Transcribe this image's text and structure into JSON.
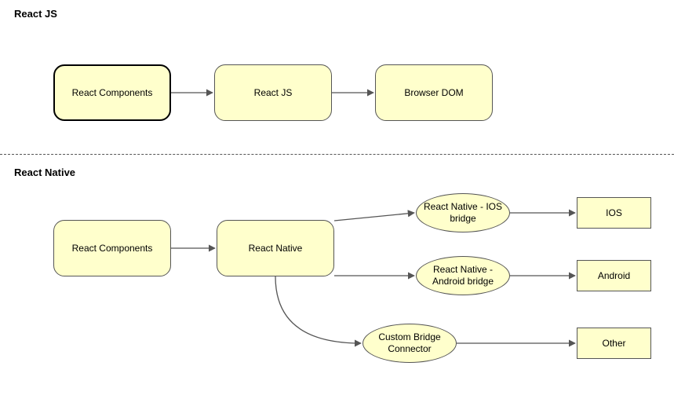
{
  "sections": {
    "reactjs": {
      "title": "React JS"
    },
    "reactnative": {
      "title": "React Native"
    }
  },
  "nodes": {
    "rjs_components": "React Components",
    "rjs_core": "React JS",
    "rjs_dom": "Browser DOM",
    "rn_components": "React Components",
    "rn_core": "React Native",
    "rn_ios_bridge": "React Native - IOS bridge",
    "rn_android_bridge": "React Native - Android bridge",
    "rn_custom_bridge": "Custom Bridge Connector",
    "rn_ios": "IOS",
    "rn_android": "Android",
    "rn_other": "Other"
  },
  "flows": {
    "reactjs": [
      [
        "React Components",
        "React JS"
      ],
      [
        "React JS",
        "Browser DOM"
      ]
    ],
    "reactnative": [
      [
        "React Components",
        "React Native"
      ],
      [
        "React Native",
        "React Native - IOS bridge"
      ],
      [
        "React Native - IOS bridge",
        "IOS"
      ],
      [
        "React Native",
        "React Native - Android bridge"
      ],
      [
        "React Native - Android bridge",
        "Android"
      ],
      [
        "React Native",
        "Custom Bridge Connector"
      ],
      [
        "Custom Bridge Connector",
        "Other"
      ]
    ]
  }
}
